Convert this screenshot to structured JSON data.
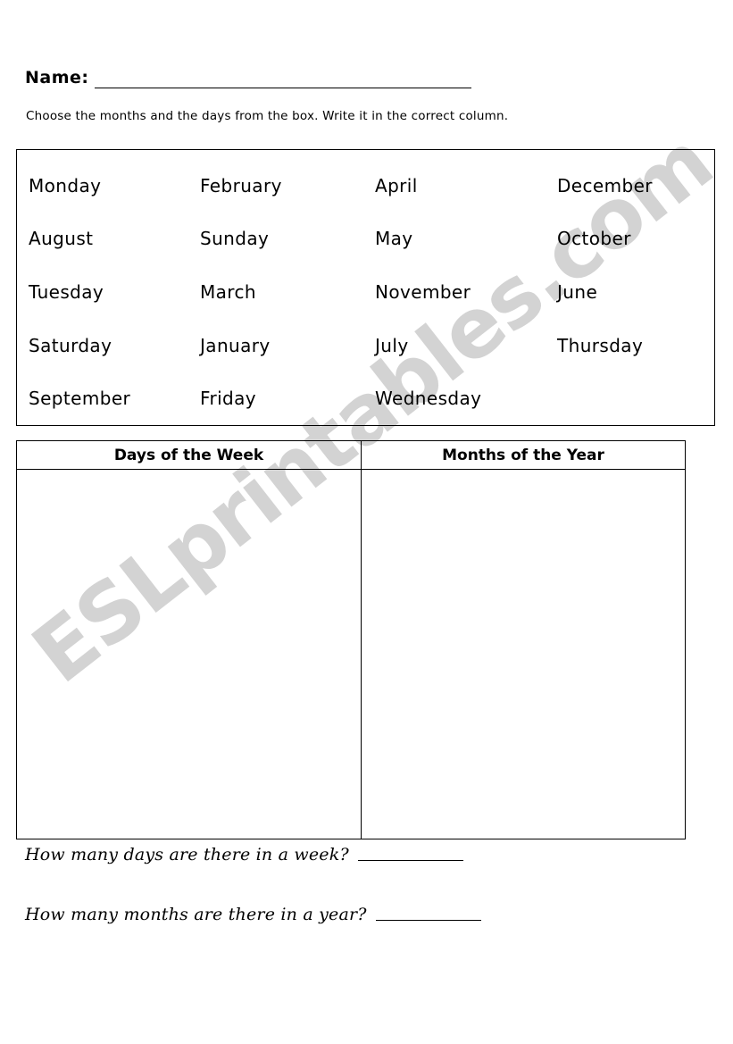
{
  "page": {
    "title": "Days of the Week and Months of the Year Worksheet"
  },
  "name_field": {
    "label": "Name:",
    "value": "",
    "placeholder": ""
  },
  "instruction": {
    "text": "Choose the months and the days from the box. Write it in the correct column."
  },
  "word_box": {
    "rows": [
      [
        "Monday",
        "February",
        "April",
        "December"
      ],
      [
        "August",
        "Sunday",
        "May",
        "October"
      ],
      [
        "Tuesday",
        "March",
        "November",
        "June"
      ],
      [
        "Saturday",
        "January",
        "July",
        "Thursday"
      ],
      [
        "September",
        "Friday",
        "Wednesday",
        ""
      ]
    ],
    "words": [
      "Monday",
      "February",
      "April",
      "December",
      "August",
      "Sunday",
      "May",
      "October",
      "Tuesday",
      "March",
      "November",
      "June",
      "Saturday",
      "January",
      "July",
      "Thursday",
      "September",
      "Friday",
      "Wednesday"
    ]
  },
  "answer_table": {
    "headers": [
      "Days of the Week",
      "Months of the Year"
    ],
    "cells": [
      "",
      ""
    ]
  },
  "questions": [
    {
      "text": "How many days are there in a week?",
      "answer": ""
    },
    {
      "text": "How many months are there in a year?",
      "answer": ""
    }
  ],
  "watermark": {
    "text": "ESLprintables.com",
    "color": "#d3d3d3"
  }
}
